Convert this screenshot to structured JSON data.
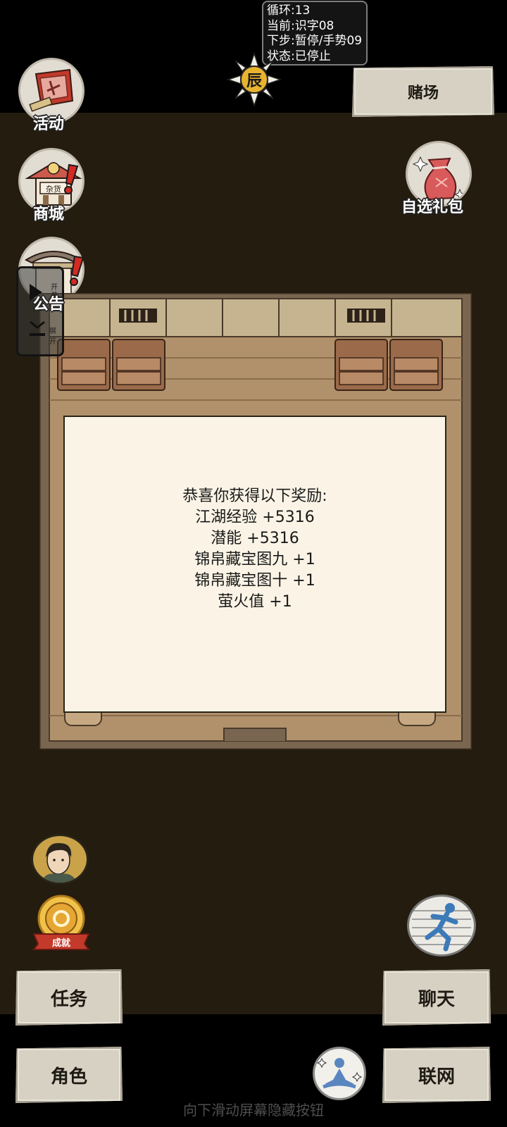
{
  "debug": {
    "loop": "循环:13",
    "current": "当前:识字08",
    "next": "下步:暂停/手势09",
    "status": "状态:已停止"
  },
  "time_icon_label": "辰",
  "top_right_button": "赌场",
  "left_menu": [
    {
      "label": "活动",
      "icon": "banner-scroll-icon"
    },
    {
      "label": "商城",
      "icon": "shop-stall-icon",
      "badge": "!"
    },
    {
      "label": "公告",
      "icon": "notice-pavilion-icon",
      "badge": "!"
    }
  ],
  "shop_sign": "杂货",
  "gift_pack": {
    "label": "自选礼包",
    "icon": "gift-pouch-icon"
  },
  "toggle": {
    "collapse": "开关",
    "expand": "展开"
  },
  "reward_dialog": {
    "title": "恭喜你获得以下奖励:",
    "items": [
      "江湖经验 +5316",
      "潜能 +5316",
      "锦帛藏宝图九 +1",
      "锦帛藏宝图十 +1",
      "萤火值 +1"
    ]
  },
  "achievement_label": "成就",
  "bottom_buttons": {
    "task": "任务",
    "chat": "聊天",
    "role": "角色",
    "network": "联网"
  },
  "gesture_hint": "向下滑动屏幕隐藏按钮",
  "colors": {
    "playfield": "#231c0f",
    "parchment": "#d6d1c3",
    "dialog": "#fbf4e6",
    "floor": "#b0916b",
    "alert": "#d42a22"
  }
}
